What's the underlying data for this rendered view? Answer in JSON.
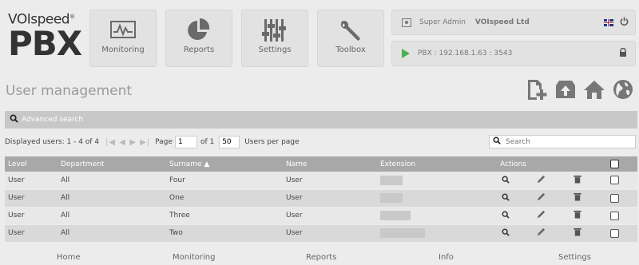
{
  "logo": {
    "brand": "VOIspeed",
    "reg": "®",
    "pbx": "PBX"
  },
  "tiles": [
    {
      "label": "Monitoring",
      "icon": "monitoring-icon"
    },
    {
      "label": "Reports",
      "icon": "pie-chart-icon"
    },
    {
      "label": "Settings",
      "icon": "sliders-icon"
    },
    {
      "label": "Toolbox",
      "icon": "wrench-icon"
    }
  ],
  "user_bar": {
    "role": "Super Admin",
    "company": "VOIspeed Ltd",
    "icons": [
      "user-card-icon",
      "uk-flag-icon",
      "power-icon"
    ]
  },
  "pbx_bar": {
    "text": "PBX : 192.168.1.63 : 3543",
    "icons": [
      "play-icon",
      "lock-icon"
    ]
  },
  "page_title": "User management",
  "title_icons": [
    "add-file-icon",
    "upload-box-icon",
    "home-icon",
    "globe-icon"
  ],
  "advanced_search": "Advanced search",
  "pagination": {
    "displayed": "Displayed users: 1 - 4 of 4",
    "page_label": "Page",
    "page_value": "1",
    "of_label": "of 1",
    "per_page_value": "50",
    "per_page_label": "Users per page",
    "search_placeholder": "Search"
  },
  "table": {
    "headers": {
      "level": "Level",
      "department": "Department",
      "surname": "Surname",
      "name": "Name",
      "extension": "Extension",
      "actions": "Actions"
    },
    "sort_indicator": "▲",
    "rows": [
      {
        "level": "User",
        "department": "All",
        "surname": "Four",
        "name": "User"
      },
      {
        "level": "User",
        "department": "All",
        "surname": "One",
        "name": "User"
      },
      {
        "level": "User",
        "department": "All",
        "surname": "Three",
        "name": "User"
      },
      {
        "level": "User",
        "department": "All",
        "surname": "Two",
        "name": "User"
      }
    ]
  },
  "footer": [
    "Home",
    "Monitoring",
    "Reports",
    "Info",
    "Settings"
  ],
  "colors": {
    "accent_green": "#4caf50",
    "header_gray": "#a8a8a8",
    "flag_red": "#cc2233",
    "flag_blue": "#1a3a8a"
  }
}
